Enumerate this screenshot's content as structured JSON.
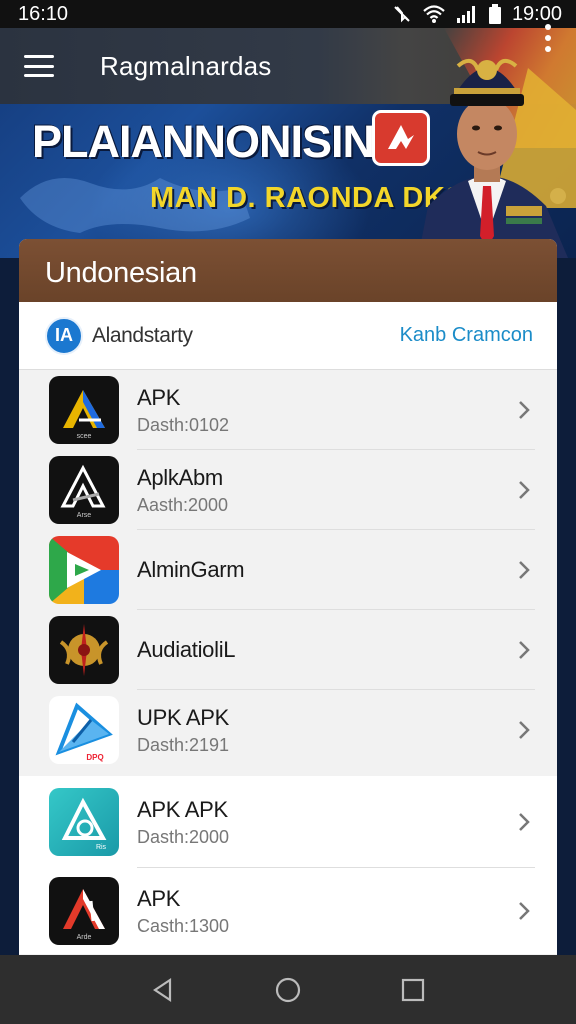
{
  "status_bar": {
    "time": "16:10",
    "right_time": "19:00",
    "icons": [
      "mute-icon",
      "wifi-icon",
      "signal-icon",
      "battery-icon"
    ]
  },
  "app_bar": {
    "title": "Ragmalnardas",
    "menu_icon": "hamburger-icon",
    "more_icon": "more-vert-icon"
  },
  "banner": {
    "title": "PLAIANNONISIN",
    "subtitle": "MAN D. RAONDA DKS"
  },
  "card": {
    "header": "Undonesian",
    "account": {
      "badge": "IA",
      "name": "Alandstarty",
      "link": "Kanb Cramcon"
    },
    "items": [
      {
        "name": "APK",
        "sub": "Dasth:0102",
        "icon_label": "scee",
        "colors": [
          "#111",
          "#e7b400",
          "#1e6ae0"
        ]
      },
      {
        "name": "AplkAbm",
        "sub": "Aasth:2000",
        "icon_label": "Arse",
        "colors": [
          "#111",
          "#ffffff",
          "#9aa"
        ]
      },
      {
        "name": "AlminGarm",
        "sub": "",
        "icon_label": "",
        "colors": [
          "#e53a2a",
          "#2ea84a",
          "#1e7ae0",
          "#f2b21b"
        ]
      },
      {
        "name": "AudiatioliL",
        "sub": "",
        "icon_label": "",
        "colors": [
          "#111",
          "#c8942a",
          "#c0201d"
        ]
      },
      {
        "name": "UPK APK",
        "sub": "Dasth:2191",
        "icon_label": "DPQ",
        "colors": [
          "#ffffff",
          "#1a8fe0",
          "#e23"
        ]
      },
      {
        "name": "APK APK",
        "sub": "Dasth:2000",
        "icon_label": "Ris",
        "colors": [
          "#24b7c4",
          "#1a9aa8",
          "#fff"
        ]
      },
      {
        "name": "APK",
        "sub": "Casth:1300",
        "icon_label": "Arde",
        "colors": [
          "#111",
          "#e23a2a",
          "#fff"
        ]
      }
    ]
  },
  "nav_bar": {
    "back_icon": "back-triangle-icon",
    "home_icon": "home-circle-icon",
    "recents_icon": "recents-square-icon"
  }
}
